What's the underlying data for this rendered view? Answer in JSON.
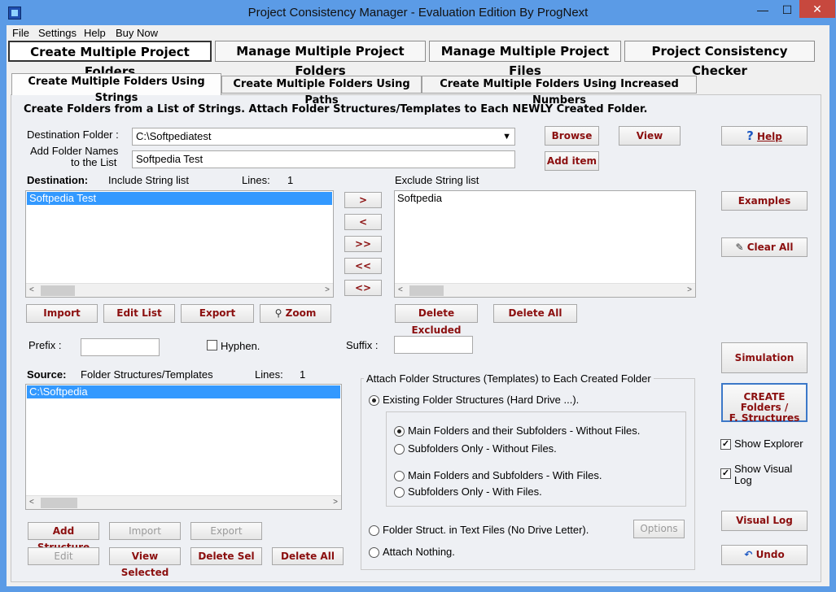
{
  "window": {
    "title": "Project Consistency Manager - Evaluation Edition  By ProgNext",
    "minimize": "—",
    "maximize": "☐",
    "close": "✕"
  },
  "menu": [
    "File",
    "Settings",
    "Help",
    "Buy Now"
  ],
  "main_tabs": [
    "Create Multiple Project Folders",
    "Manage Multiple Project Folders",
    "Manage Multiple Project Files",
    "Project Consistency Checker"
  ],
  "sub_tabs": [
    "Create Multiple Folders Using Strings",
    "Create Multiple Folders Using Paths",
    "Create Multiple Folders Using Increased Numbers"
  ],
  "panel": {
    "heading": "Create Folders from a List of Strings. Attach Folder Structures/Templates to Each NEWLY Created Folder.",
    "destination_folder_label": "Destination Folder :",
    "destination_folder_value": "C:\\Softpediatest",
    "add_names_label_1": "Add Folder Names",
    "add_names_label_2": "to the List",
    "add_names_value": "Softpedia Test",
    "browse": "Browse",
    "view": "View",
    "add_item": "Add item",
    "help": "Help",
    "destination_label": "Destination:",
    "include_label": "Include String list",
    "lines_label": "Lines:",
    "include_lines": "1",
    "include_items": [
      "Softpedia Test"
    ],
    "exclude_label": "Exclude String list",
    "exclude_items": [
      "Softpedia"
    ],
    "move_right": ">",
    "move_left": "<",
    "move_all_right": ">>",
    "move_all_left": "<<",
    "swap": "<>",
    "examples": "Examples",
    "clear_all": "Clear All",
    "import": "Import",
    "edit_list": "Edit List",
    "export": "Export",
    "zoom": "Zoom",
    "delete_excluded": "Delete Excluded",
    "delete_all_excl": "Delete All",
    "prefix_label": "Prefix :",
    "hyphen_label": "Hyphen.",
    "suffix_label": "Suffix :",
    "source_label": "Source:",
    "templates_label": "Folder Structures/Templates",
    "source_lines": "1",
    "source_items": [
      "C:\\Softpedia"
    ],
    "add_structure": "Add Structure",
    "src_import": "Import",
    "src_export": "Export",
    "src_edit": "Edit",
    "view_selected": "View Selected",
    "delete_sel": "Delete Sel",
    "delete_all_src": "Delete All",
    "attach_title": "Attach Folder Structures (Templates) to Each Created Folder",
    "opt_existing": "Existing Folder Structures (Hard Drive ...).",
    "opt_main_no_files": "Main Folders and their Subfolders - Without Files.",
    "opt_sub_no_files": "Subfolders Only - Without Files.",
    "opt_main_files": "Main Folders and Subfolders - With Files.",
    "opt_sub_files": "Subfolders Only - With Files.",
    "opt_text_files": "Folder Struct. in Text Files (No Drive Letter).",
    "options": "Options",
    "opt_nothing": "Attach Nothing.",
    "simulation": "Simulation",
    "create_1": "CREATE Folders /",
    "create_2": "F. Structures",
    "show_explorer": "Show Explorer",
    "show_visual_1": "Show Visual",
    "show_visual_2": "Log",
    "visual_log": "Visual Log",
    "undo": "Undo"
  }
}
